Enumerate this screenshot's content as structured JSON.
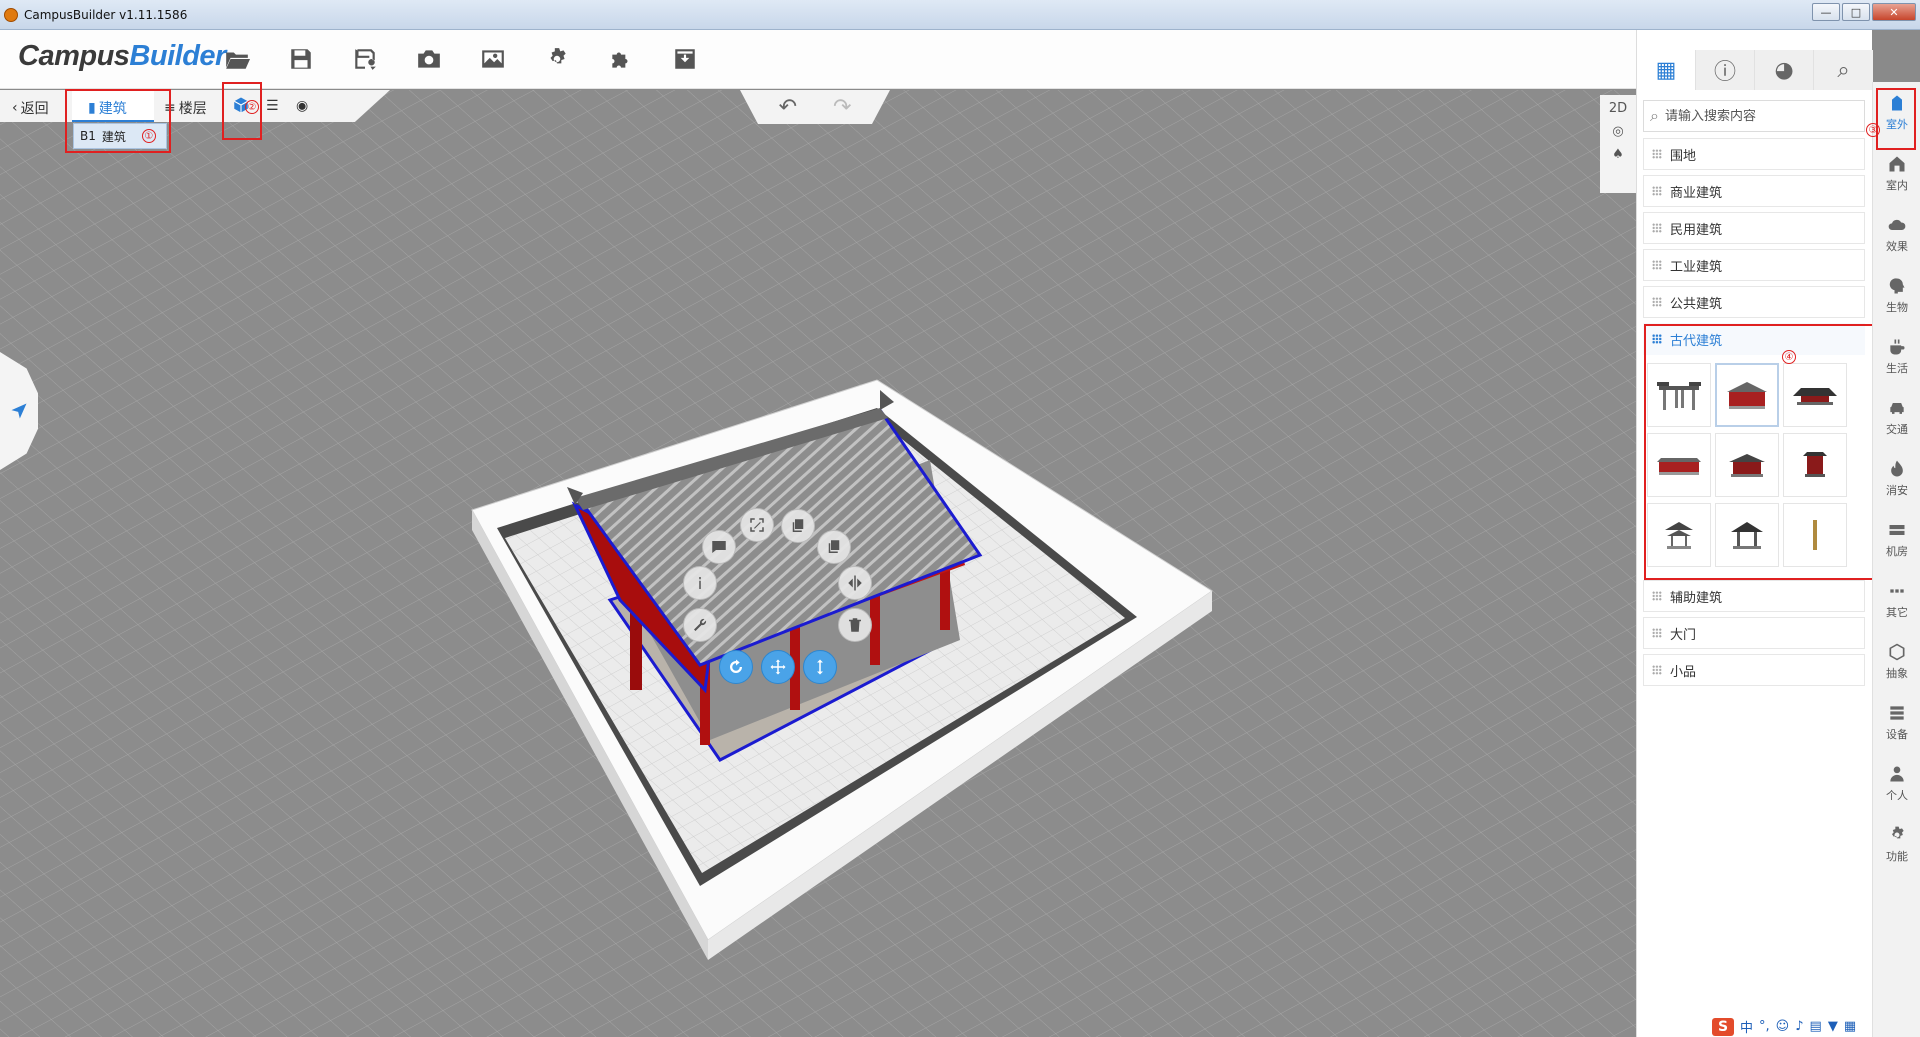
{
  "window": {
    "title": "CampusBuilder v1.11.1586",
    "buttons": [
      "—",
      "□",
      "✕"
    ]
  },
  "logo": {
    "part1": "Campus",
    "part2": "Builder"
  },
  "toolbar": {
    "icons": [
      "folder-open-icon",
      "save-icon",
      "save-as-icon",
      "camera-icon",
      "image-icon",
      "settings-gear-icon",
      "plugin-puzzle-icon",
      "download-box-icon"
    ]
  },
  "subbar": {
    "back_label": "返回",
    "building_tab": "建筑",
    "floor_tab": "楼层"
  },
  "dropdown": {
    "level": "B1",
    "label": "建筑"
  },
  "annotations": [
    "①",
    "②",
    "③",
    "④"
  ],
  "viewtools": {
    "mode": "2D"
  },
  "panel": {
    "search_placeholder": "请输入搜索内容",
    "categories_top": [
      "围地",
      "商业建筑",
      "民用建筑",
      "工业建筑",
      "公共建筑"
    ],
    "active_category": "古代建筑",
    "categories_bottom": [
      "辅助建筑",
      "大门",
      "小品"
    ]
  },
  "strip": {
    "items": [
      "室外",
      "室内",
      "效果",
      "生物",
      "生活",
      "交通",
      "消安",
      "机房",
      "其它",
      "抽象",
      "设备",
      "个人",
      "功能"
    ]
  },
  "ime": {
    "logo": "S",
    "text": "中"
  },
  "colors": {
    "accent": "#2c7fd5",
    "annotation_red": "#e02020",
    "scene_gray": "#8a8a8a"
  }
}
